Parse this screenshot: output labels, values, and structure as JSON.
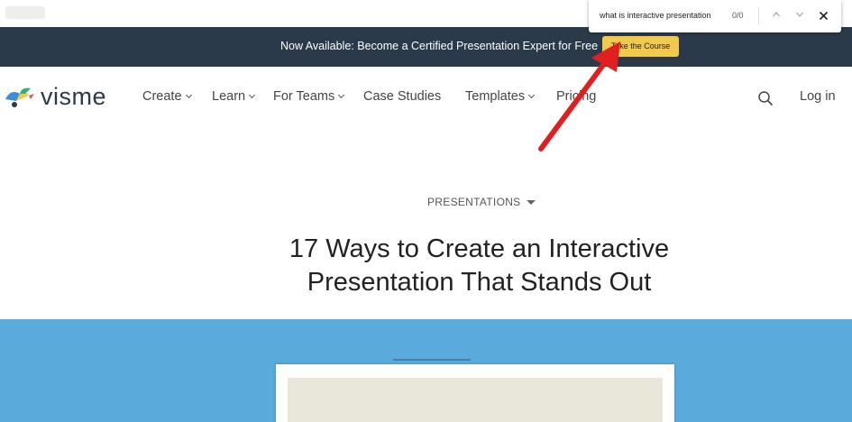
{
  "find_bar": {
    "query": "what is interactive presentation",
    "count": "0/0",
    "prev_icon": "chevron-up-icon",
    "next_icon": "chevron-down-icon",
    "close_icon": "close-icon"
  },
  "banner": {
    "text": "Now Available: Become a Certified Presentation Expert for Free",
    "button_label": "Take the Course"
  },
  "nav": {
    "logo": "visme",
    "items": [
      {
        "label": "Create",
        "dropdown": true
      },
      {
        "label": "Learn",
        "dropdown": true
      },
      {
        "label": "For Teams",
        "dropdown": true
      },
      {
        "label": "Case Studies",
        "dropdown": false
      },
      {
        "label": "Templates",
        "dropdown": true
      },
      {
        "label": "Pricing",
        "dropdown": false
      }
    ],
    "search_icon": "search-icon",
    "login_label": "Log in"
  },
  "article": {
    "category": "PRESENTATIONS",
    "title_line1": "17 Ways to Create an Interactive",
    "title_line2": "Presentation That Stands Out"
  },
  "colors": {
    "banner_bg": "#2b3a4a",
    "banner_button": "#f2c94c",
    "hero_bg": "#5aaadc",
    "annotation_arrow": "#e02020"
  }
}
